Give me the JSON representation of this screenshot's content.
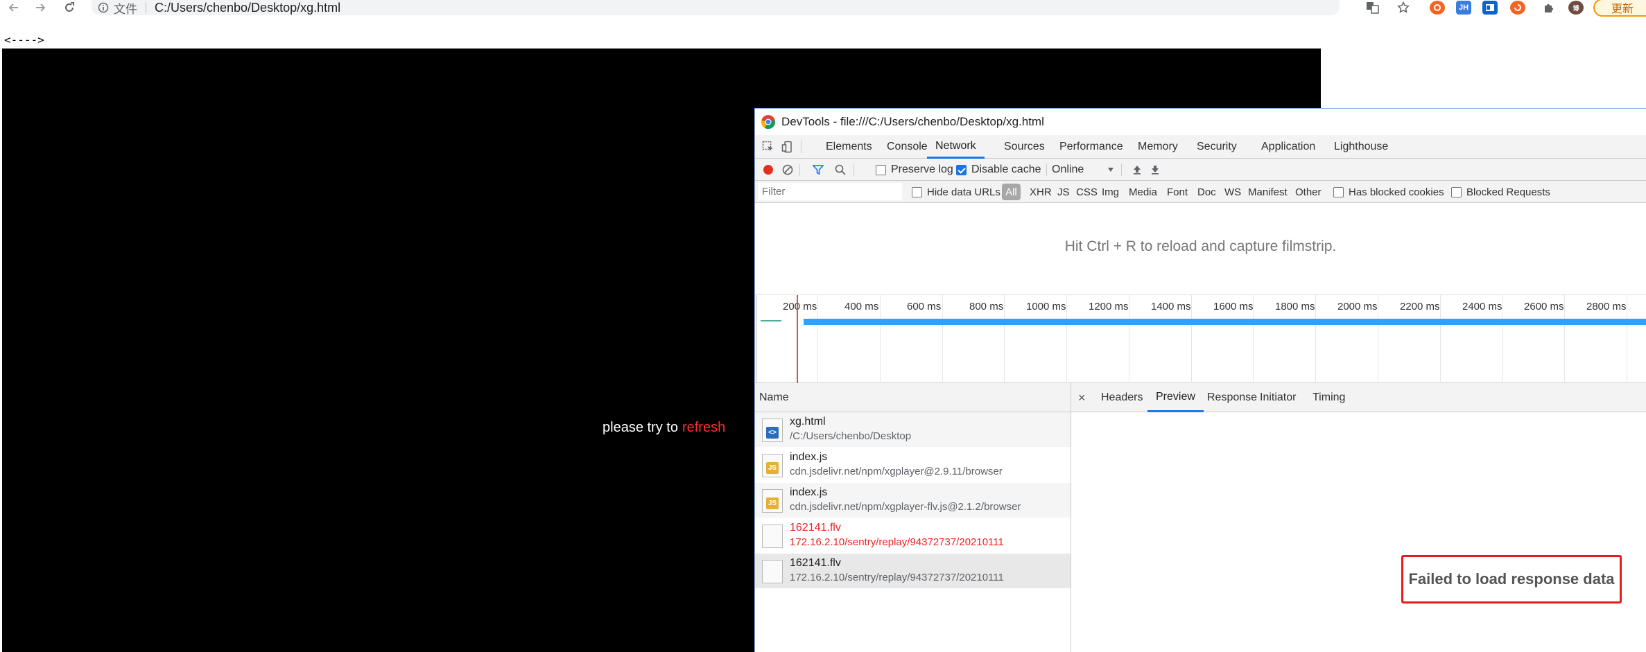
{
  "browser": {
    "scheme_label": "文件",
    "url": "C:/Users/chenbo/Desktop/xg.html",
    "update_label": "更新",
    "ext_jh": "JH",
    "avatar_label": "博"
  },
  "page": {
    "arrow_text": "<---->",
    "error_prefix": "please try to",
    "refresh_label": "refresh"
  },
  "devtools": {
    "title": "DevTools - file:///C:/Users/chenbo/Desktop/xg.html",
    "tabs": [
      "Elements",
      "Console",
      "Network",
      "Sources",
      "Performance",
      "Memory",
      "Security",
      "Application",
      "Lighthouse"
    ],
    "active_tab": "Network",
    "toolbar": {
      "preserve_log": "Preserve log",
      "disable_cache": "Disable cache",
      "throttle": "Online"
    },
    "filter": {
      "placeholder": "Filter",
      "hide_data_urls": "Hide data URLs",
      "types": [
        "All",
        "XHR",
        "JS",
        "CSS",
        "Img",
        "Media",
        "Font",
        "Doc",
        "WS",
        "Manifest",
        "Other"
      ],
      "has_blocked_cookies": "Has blocked cookies",
      "blocked_requests": "Blocked Requests"
    },
    "filmstrip_message": "Hit Ctrl + R to reload and capture filmstrip.",
    "timeline_ticks": [
      "200 ms",
      "400 ms",
      "600 ms",
      "800 ms",
      "1000 ms",
      "1200 ms",
      "1400 ms",
      "1600 ms",
      "1800 ms",
      "2000 ms",
      "2200 ms",
      "2400 ms",
      "2600 ms",
      "2800 ms"
    ],
    "name_header": "Name",
    "requests": [
      {
        "name": "xg.html",
        "path": "/C:/Users/chenbo/Desktop",
        "type": "html",
        "failed": false
      },
      {
        "name": "index.js",
        "path": "cdn.jsdelivr.net/npm/xgplayer@2.9.11/browser",
        "type": "js",
        "failed": false
      },
      {
        "name": "index.js",
        "path": "cdn.jsdelivr.net/npm/xgplayer-flv.js@2.1.2/browser",
        "type": "js",
        "failed": false
      },
      {
        "name": "162141.flv",
        "path": "172.16.2.10/sentry/replay/94372737/20210111",
        "type": "file",
        "failed": true
      },
      {
        "name": "162141.flv",
        "path": "172.16.2.10/sentry/replay/94372737/20210111",
        "type": "file",
        "failed": false
      }
    ],
    "detail_tabs": [
      "Headers",
      "Preview",
      "Response",
      "Initiator",
      "Timing"
    ],
    "active_detail_tab": "Preview",
    "close_symbol": "×",
    "preview_message": "Failed to load response data"
  }
}
